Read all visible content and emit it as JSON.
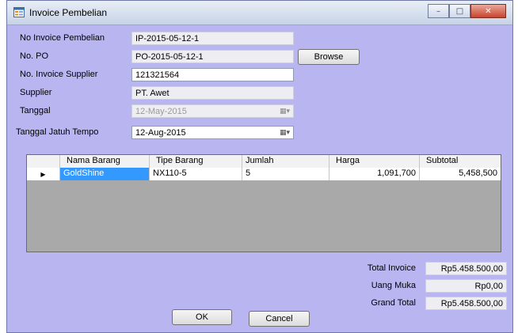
{
  "window": {
    "title": "Invoice Pembelian",
    "controls": {
      "minimize": "–",
      "maximize": "□",
      "close": "✕"
    }
  },
  "form": {
    "no_invoice_pembelian": {
      "label": "No Invoice Pembelian",
      "value": "IP-2015-05-12-1"
    },
    "no_po": {
      "label": "No. PO",
      "value": "PO-2015-05-12-1"
    },
    "browse_label": "Browse",
    "no_invoice_supplier": {
      "label": "No. Invoice Supplier",
      "value": "121321564"
    },
    "supplier": {
      "label": "Supplier",
      "value": "PT. Awet"
    },
    "tanggal": {
      "label": "Tanggal",
      "value": "12-May-2015"
    },
    "tanggal_jatuh_tempo": {
      "label": "Tanggal Jatuh Tempo",
      "value": "12-Aug-2015"
    }
  },
  "grid": {
    "columns": [
      "Nama Barang",
      "Tipe Barang",
      "Jumlah",
      "Harga",
      "Subtotal"
    ],
    "row_indicator": "▶",
    "rows": [
      {
        "nama_barang": "GoldShine",
        "tipe_barang": "NX110-5",
        "jumlah": "5",
        "harga": "1,091,700",
        "subtotal": "5,458,500"
      }
    ]
  },
  "totals": {
    "total_invoice": {
      "label": "Total Invoice",
      "value": "Rp5.458.500,00"
    },
    "uang_muka": {
      "label": "Uang Muka",
      "value": "Rp0,00"
    },
    "grand_total": {
      "label": "Grand Total",
      "value": "Rp5.458.500,00"
    }
  },
  "actions": {
    "ok_label": "OK",
    "cancel_label": "Cancel"
  },
  "icons": {
    "app": "form-window-icon",
    "calendar": "calendar-dropdown-icon",
    "row_pointer": "current-row-arrow-icon"
  },
  "colors": {
    "background": "#b8b5f0",
    "selection": "#3399ff",
    "close_button": "#c9432b"
  }
}
